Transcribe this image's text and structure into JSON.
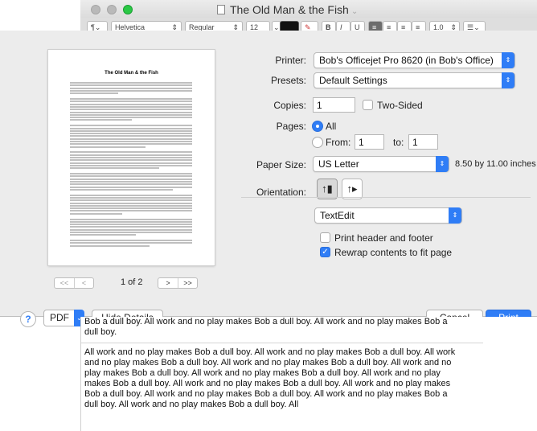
{
  "window": {
    "title": "The Old Man & the Fish",
    "toolbar": {
      "font_family": "Helvetica",
      "font_style": "Regular",
      "font_size": "12",
      "line_spacing": "1.0"
    }
  },
  "preview": {
    "page_title": "The Old Man & the Fish",
    "page_count": "1 of 2",
    "first_btn": "<<",
    "prev_btn": "<",
    "next_btn": ">",
    "last_btn": ">>"
  },
  "settings": {
    "printer_label": "Printer:",
    "printer_value": "Bob's Officejet Pro 8620 (in Bob's Office)",
    "presets_label": "Presets:",
    "presets_value": "Default Settings",
    "copies_label": "Copies:",
    "copies_value": "1",
    "two_sided_label": "Two-Sided",
    "two_sided_checked": false,
    "pages_label": "Pages:",
    "pages_all_label": "All",
    "pages_from_label": "From:",
    "pages_from_value": "1",
    "pages_to_label": "to:",
    "pages_to_value": "1",
    "paper_size_label": "Paper Size:",
    "paper_size_value": "US Letter",
    "paper_dimensions": "8.50 by 11.00 inches",
    "orientation_label": "Orientation:",
    "app_section_value": "TextEdit",
    "print_header_label": "Print header and footer",
    "print_header_checked": false,
    "rewrap_label": "Rewrap contents to fit page",
    "rewrap_checked": true
  },
  "footer": {
    "help_label": "?",
    "pdf_label": "PDF",
    "hide_details_label": "Hide Details",
    "cancel_label": "Cancel",
    "print_label": "Print"
  },
  "document": {
    "para1": "Bob a dull boy. All work and no play makes Bob a dull boy. All work and no play makes Bob a dull boy.",
    "para2": "All work and no play makes Bob a dull boy. All work and no play makes Bob a dull boy. All work and no play makes Bob a dull boy. All work and no play makes Bob a dull boy. All work and no play makes Bob a dull boy. All work and no play makes Bob a dull boy. All work and no play makes Bob a dull boy. All work and no play makes Bob a dull boy. All work and no play makes Bob a dull boy. All work and no play makes Bob a dull boy. All work and no play makes Bob a dull boy. All work and no play makes Bob a dull boy. All"
  },
  "colors": {
    "accent": "#2f7df6",
    "sheet_bg": "#ececec"
  }
}
